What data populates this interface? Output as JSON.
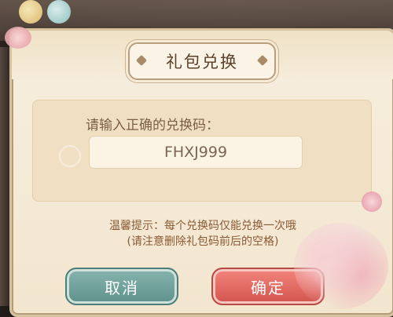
{
  "dialog": {
    "title": "礼包兑换",
    "input_label": "请输入正确的兑换码：",
    "code_value": "FHXJ999",
    "tip_line1": "温馨提示：每个兑换码仅能兑换一次哦",
    "tip_line2": "(请注意删除礼包码前后的空格)",
    "cancel_label": "取消",
    "confirm_label": "确定"
  },
  "colors": {
    "cancel_button": "#5e928b",
    "confirm_button": "#d2544e",
    "panel_bg": "#f3e6cf",
    "title_text": "#5a3f2b"
  },
  "decor": {
    "birds": [
      "bird-yellow",
      "bird-blue"
    ],
    "flowers": [
      "peony-icon"
    ]
  }
}
